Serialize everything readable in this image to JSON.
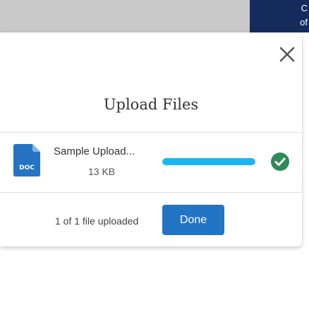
{
  "background": {
    "header_text": "C of"
  },
  "modal": {
    "title": "Upload Files",
    "close_icon": "close-icon",
    "file": {
      "icon": "doc-file-icon",
      "icon_label": "DOC",
      "name": "Sample Upload...",
      "size": "13 KB",
      "progress": 1.0,
      "status_icon": "check-circle-icon"
    },
    "footer": {
      "status": "1 of 1 file uploaded",
      "done_label": "Done"
    }
  },
  "colors": {
    "navy": "#142b5c",
    "progress": "#1ab6f0",
    "success": "#2e8b57",
    "primary_button": "#2274c4",
    "doc_icon": "#2474c3"
  }
}
